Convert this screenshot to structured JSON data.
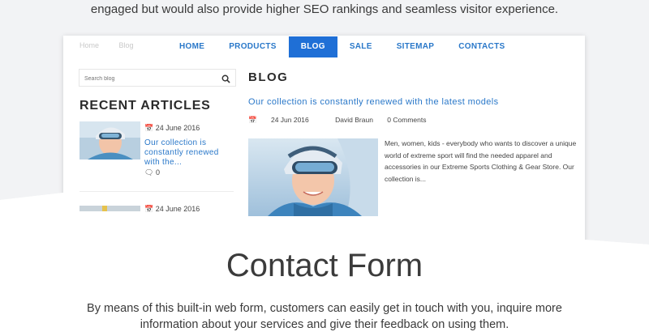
{
  "intro": {
    "text": "engaged but would also provide higher SEO rankings and seamless visitor experience."
  },
  "breadcrumb": {
    "home": "Home",
    "blog": "Blog"
  },
  "nav": {
    "items": [
      "HOME",
      "PRODUCTS",
      "BLOG",
      "SALE",
      "SITEMAP",
      "CONTACTS"
    ],
    "active": "BLOG"
  },
  "sidebar": {
    "search_placeholder": "Search blog",
    "recent_title": "RECENT ARTICLES",
    "articles": [
      {
        "date": "24 June 2016",
        "title": "Our collection is constantly renewed with the...",
        "comments": "0"
      },
      {
        "date": "24 June 2016"
      }
    ]
  },
  "main": {
    "heading": "BLOG",
    "post": {
      "title": "Our collection is constantly renewed with the latest models",
      "date": "24 Jun 2016",
      "author": "David Braun",
      "comments": "0 Comments",
      "excerpt": "Men, women, kids - everybody who wants to discover a unique world of extreme sport will find the needed apparel and accessories in our Extreme Sports Clothing & Gear Store. Our collection is..."
    }
  },
  "contact": {
    "title": "Contact Form",
    "description": "By means of this built-in web form, customers can easily get in touch with you, inquire more information about your services and give their feedback on using them."
  },
  "colors": {
    "accent": "#1f6fd6",
    "link": "#2a78c9",
    "background_gray": "#f2f3f5"
  }
}
